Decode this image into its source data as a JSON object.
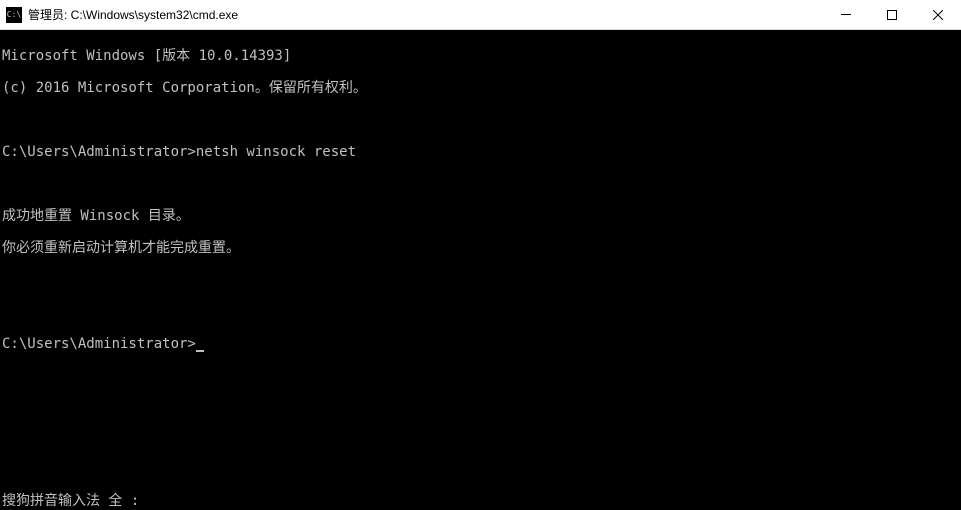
{
  "window": {
    "title": "管理员: C:\\Windows\\system32\\cmd.exe",
    "icon_label": "C:\\"
  },
  "terminal": {
    "lines": [
      "Microsoft Windows [版本 10.0.14393]",
      "(c) 2016 Microsoft Corporation。保留所有权利。",
      "",
      "C:\\Users\\Administrator>netsh winsock reset",
      "",
      "成功地重置 Winsock 目录。",
      "你必须重新启动计算机才能完成重置。",
      "",
      "",
      "C:\\Users\\Administrator>"
    ],
    "prompt_path": "C:\\Users\\Administrator>",
    "command": "netsh winsock reset",
    "output_line1": "成功地重置 Winsock 目录。",
    "output_line2": "你必须重新启动计算机才能完成重置。"
  },
  "ime": {
    "text": "搜狗拼音输入法 全 :"
  }
}
